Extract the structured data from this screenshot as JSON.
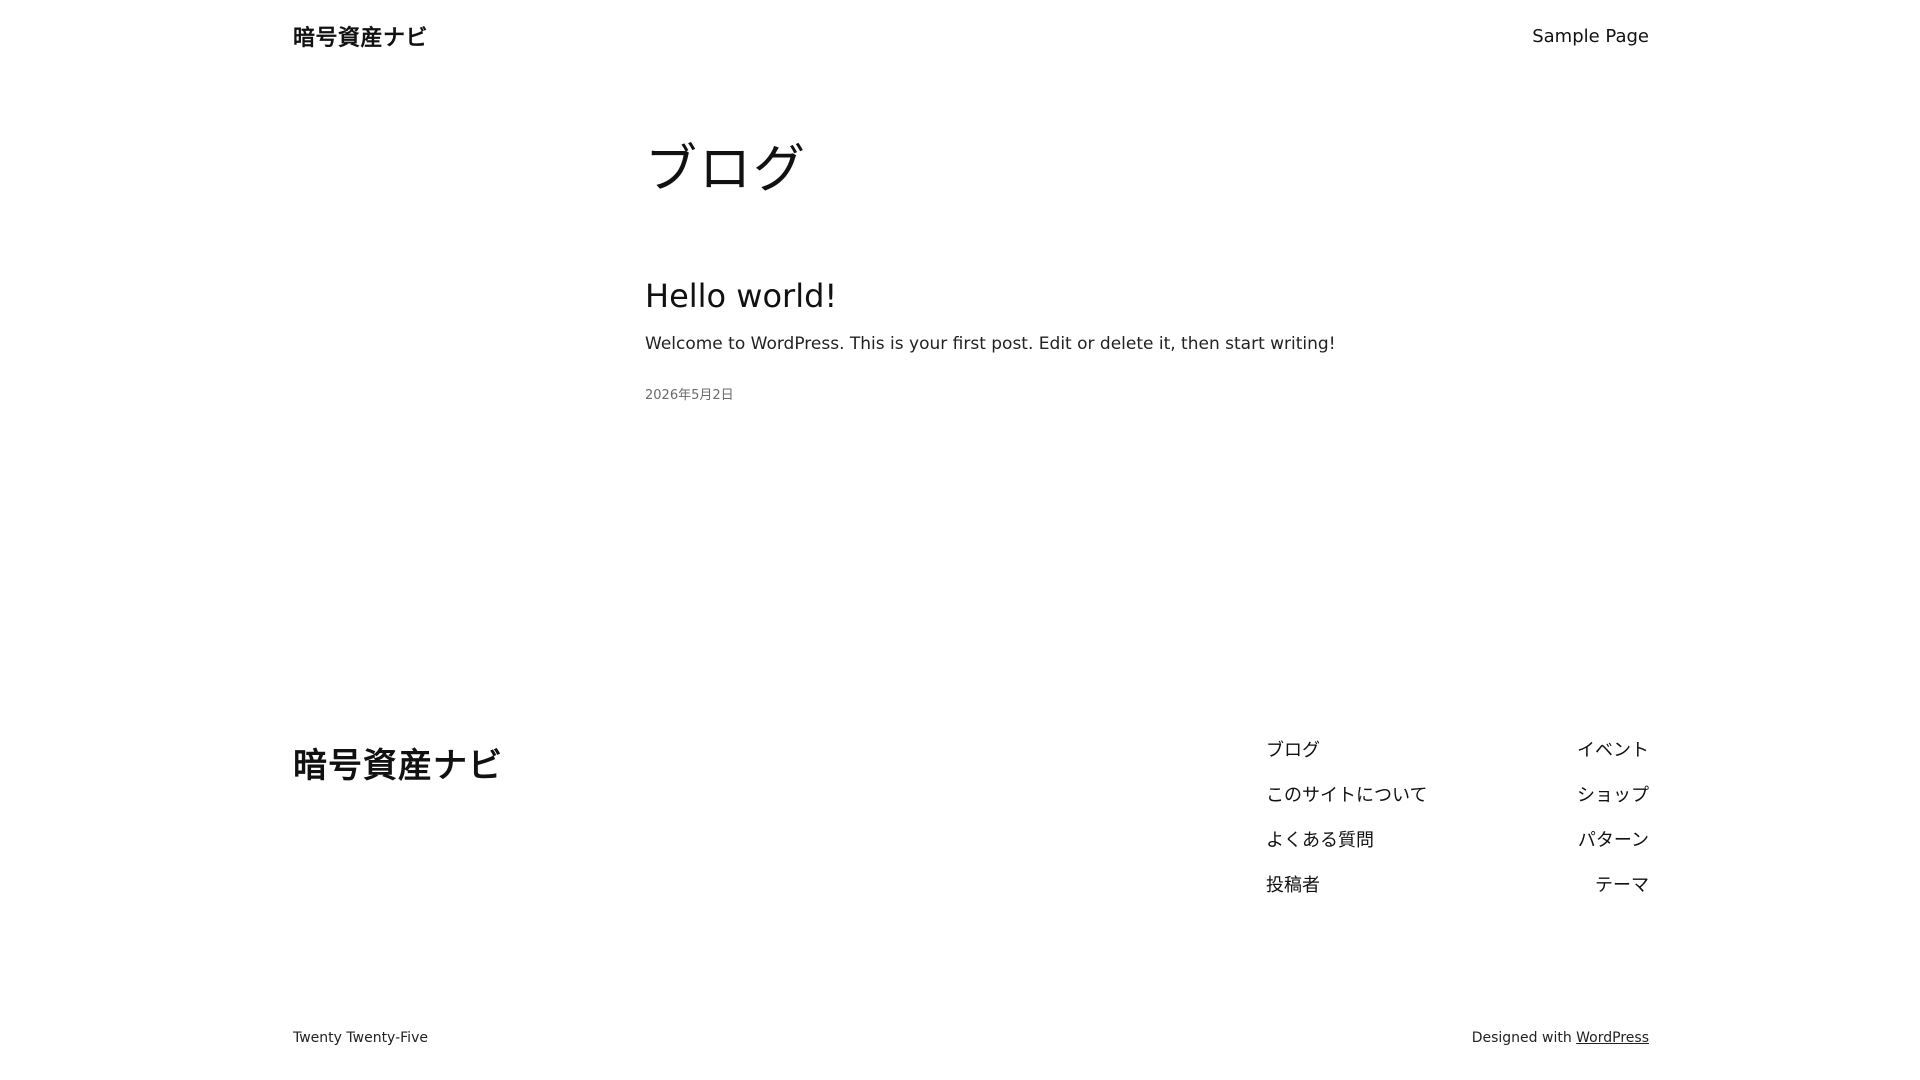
{
  "header": {
    "site_title": "暗号資産ナビ",
    "nav": [
      "Sample Page"
    ]
  },
  "main": {
    "heading": "ブログ",
    "posts": [
      {
        "title": "Hello world!",
        "excerpt": "Welcome to WordPress. This is your first post. Edit or delete it, then start writing!",
        "date": "2026年5月2日"
      }
    ]
  },
  "footer": {
    "site_title": "暗号資産ナビ",
    "nav_col1": [
      "ブログ",
      "このサイトについて",
      "よくある質問",
      "投稿者"
    ],
    "nav_col2": [
      "イベント",
      "ショップ",
      "パターン",
      "テーマ"
    ],
    "theme_name": "Twenty Twenty-Five",
    "designed_with_prefix": "Designed with ",
    "designed_with_link": "WordPress"
  }
}
